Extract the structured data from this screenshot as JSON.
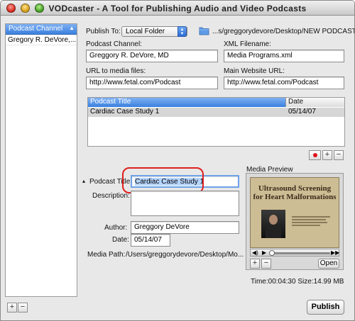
{
  "window": {
    "title": "VODcaster -  A Tool for Publishing Audio and Video Podcasts"
  },
  "sidebar": {
    "header": "Podcast Channel",
    "items": [
      "Gregory R. DeVore,..."
    ],
    "add_label": "+",
    "remove_label": "−"
  },
  "publish_to": {
    "label": "Publish To:",
    "selected": "Local Folder",
    "path": "...s/greggorydevore/Desktop/NEW PODCAST"
  },
  "channel": {
    "podcast_channel_label": "Podcast Channel:",
    "podcast_channel_value": "Greggory R. DeVore, MD",
    "xml_filename_label": "XML Filename:",
    "xml_filename_value": "Media Programs.xml",
    "media_url_label": "URL to media files:",
    "media_url_value": "http://www.fetal.com/Podcast",
    "website_url_label": "Main Website URL:",
    "website_url_value": "http://www.fetal.com/Podcast"
  },
  "episodes_table": {
    "columns": [
      "Podcast Title",
      "Date"
    ],
    "rows": [
      {
        "title": "Cardiac Case Study 1",
        "date": "05/14/07"
      }
    ],
    "add_label": "+",
    "remove_label": "−"
  },
  "episode": {
    "disclosure": "▴",
    "title_label": "Podcast Title:",
    "title_value": "Cardiac Case Study 1",
    "description_label": "Description:",
    "description_value": "",
    "author_label": "Author:",
    "author_value": "Greggory DeVore",
    "date_label": "Date:",
    "date_value": "05/14/07",
    "media_path_label": "Media Path:",
    "media_path_value": "/Users/greggorydevore/Desktop/Mo..."
  },
  "media_preview": {
    "label": "Media Preview",
    "slide_title_line1": "Ultrasound Screening",
    "slide_title_line2": "for Heart Malformations",
    "zoom_in": "+",
    "zoom_out": "−",
    "open_label": "Open",
    "info": "Time:00:04:30 Size:14.99 MB"
  },
  "actions": {
    "publish_label": "Publish"
  },
  "colors": {
    "selection_blue": "#3a80de",
    "highlight_ring": "#e02020",
    "record": "#e0141a"
  }
}
